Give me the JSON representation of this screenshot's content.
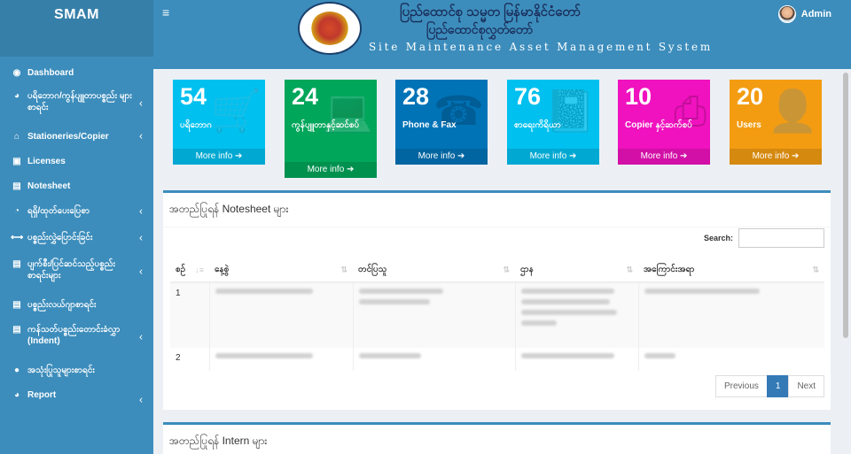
{
  "app": {
    "title": "SMAM"
  },
  "header": {
    "brand_line1": "ပြည်ထောင်စု သမ္မတ မြန်မာနိုင်ငံတော်",
    "brand_line2": "ပြည်ထောင်စုလွှတ်တော်",
    "brand_sub": "Site Maintenance Asset Management System",
    "user_name": "Admin",
    "menu_icon": "hamburger-icon"
  },
  "sidebar": {
    "items": [
      {
        "label": "Dashboard",
        "icon": "dashboard-icon",
        "glyph": "◉",
        "chev": false
      },
      {
        "label": "ပရိဘောဂ/ကွန်ပျူတာပစ္စည်း များစာရင်း",
        "icon": "globe-icon",
        "glyph": "◕",
        "chev": true
      },
      {
        "label": "Stationeries/Copier",
        "icon": "home-icon",
        "glyph": "⌂",
        "chev": true
      },
      {
        "label": "Licenses",
        "icon": "save-icon",
        "glyph": "▣",
        "chev": false
      },
      {
        "label": "Notesheet",
        "icon": "file-icon",
        "glyph": "▤",
        "chev": false
      },
      {
        "label": "ရရှိ/ထုတ်ပေးပြေစာ",
        "icon": "pie-icon",
        "glyph": "◔",
        "chev": true
      },
      {
        "label": "ပစ္စည်းလွှဲပြောင်းခြင်း",
        "icon": "transfer-icon",
        "glyph": "⟷",
        "chev": true
      },
      {
        "label": "ပျက်စီး/ပြင်ဆင်သည့်ပစ္စည်း စာရင်းများ",
        "icon": "file-icon",
        "glyph": "▤",
        "chev": true
      },
      {
        "label": "ပစ္စည်းလယ်ဂျာစာရင်း",
        "icon": "file-icon",
        "glyph": "▤",
        "chev": false
      },
      {
        "label": "ကန်သတ်ပစ္စည်းတောင်းခံလွှာ (Indent)",
        "icon": "file-icon",
        "glyph": "▤",
        "chev": true
      },
      {
        "label": "အသုံးပြုသူများစာရင်း",
        "icon": "user-icon",
        "glyph": "●",
        "chev": false
      },
      {
        "label": "Report",
        "icon": "chart-icon",
        "glyph": "◕",
        "chev": true
      }
    ]
  },
  "tiles": [
    {
      "count": "54",
      "label": "ပရိဘောဂ",
      "more": "More info ➔",
      "color": "#00c0ef",
      "icon": "cart-icon",
      "glyph": "🛒"
    },
    {
      "count": "24",
      "label": "ကွန်ပျူတာနှင့်ဆင်စပ်",
      "more": "More info ➔",
      "color": "#00a65a",
      "icon": "laptop-icon",
      "glyph": "💻"
    },
    {
      "count": "28",
      "label": "Phone & Fax",
      "more": "More info ➔",
      "color": "#0073b7",
      "icon": "fax-icon",
      "glyph": "☎"
    },
    {
      "count": "76",
      "label": "စာရေးကိရိယာ",
      "more": "More info ➔",
      "color": "#00c0ef",
      "icon": "book-icon",
      "glyph": "📓"
    },
    {
      "count": "10",
      "label": "Copier နှင့်ဆက်စပ်",
      "more": "More info ➔",
      "color": "#f012be",
      "icon": "copier-icon",
      "glyph": "⎙"
    },
    {
      "count": "20",
      "label": "Users",
      "more": "More info ➔",
      "color": "#f39c12",
      "icon": "user-plus-icon",
      "glyph": "👤"
    }
  ],
  "notesheet_panel": {
    "title": "အတည်ပြုရန် Notesheet များ",
    "search_label": "Search:",
    "columns": [
      "စဉ်",
      "နေ့စွဲ",
      "တင်ပြသူ",
      "ဌာန",
      "အကြောင်းအရာ"
    ],
    "rows": [
      {
        "no": "1"
      },
      {
        "no": "2"
      }
    ],
    "pager": {
      "prev": "Previous",
      "page": "1",
      "next": "Next"
    }
  },
  "intern_panel": {
    "title": "အတည်ပြုရန် Intern များ"
  }
}
